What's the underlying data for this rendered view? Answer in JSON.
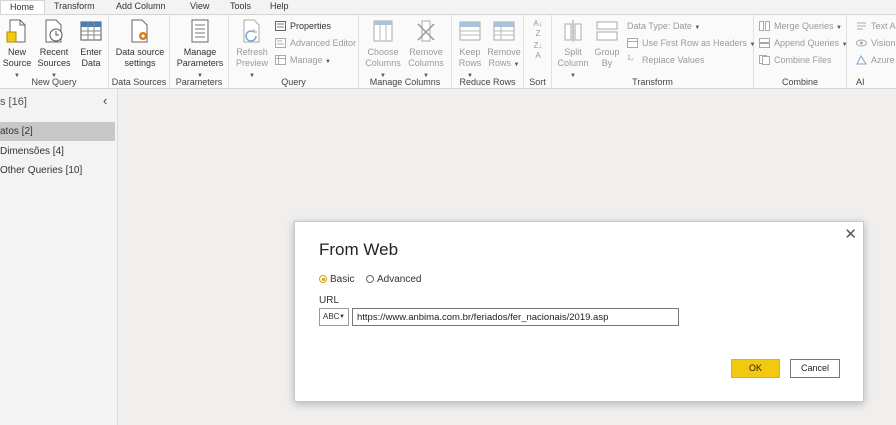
{
  "tabs": [
    "Home",
    "Transform",
    "Add Column",
    "View",
    "Tools",
    "Help"
  ],
  "ribbon": {
    "new_query": {
      "label": "New Query",
      "new_source": [
        "New",
        "Source"
      ],
      "recent_sources": [
        "Recent",
        "Sources"
      ],
      "enter_data": [
        "Enter",
        "Data"
      ]
    },
    "data_sources": {
      "label": "Data Sources",
      "settings": [
        "Data source",
        "settings"
      ]
    },
    "parameters": {
      "label": "Parameters",
      "manage": [
        "Manage",
        "Parameters"
      ]
    },
    "query": {
      "label": "Query",
      "refresh": [
        "Refresh",
        "Preview"
      ],
      "properties": "Properties",
      "advanced_editor": "Advanced Editor",
      "manage": "Manage"
    },
    "manage_columns": {
      "label": "Manage Columns",
      "choose": [
        "Choose",
        "Columns"
      ],
      "remove": [
        "Remove",
        "Columns"
      ]
    },
    "reduce_rows": {
      "label": "Reduce Rows",
      "keep": [
        "Keep",
        "Rows"
      ],
      "remove": [
        "Remove",
        "Rows"
      ]
    },
    "sort": {
      "label": "Sort"
    },
    "transform": {
      "label": "Transform",
      "split": [
        "Split",
        "Column"
      ],
      "group": [
        "Group",
        "By"
      ],
      "data_type": "Data Type: Date",
      "first_row": "Use First Row as Headers",
      "replace": "Replace Values"
    },
    "combine": {
      "label": "Combine",
      "merge": "Merge Queries",
      "append": "Append Queries",
      "files": "Combine Files"
    },
    "ai": {
      "label": "AI",
      "text": "Text An",
      "vision": "Vision",
      "azure": "Azure I"
    }
  },
  "queries_pane": {
    "title": "s [16]",
    "items": [
      "atos [2]",
      "Dimensões [4]",
      "Other Queries [10]"
    ]
  },
  "dialog": {
    "title": "From Web",
    "radio_basic": "Basic",
    "radio_advanced": "Advanced",
    "url_label": "URL",
    "type_value": "ABC",
    "url_value": "https://www.anbima.com.br/feriados/fer_nacionais/2019.asp",
    "ok": "OK",
    "cancel": "Cancel"
  },
  "colors": {
    "accent_yellow": "#f2c811",
    "ribbon_bg": "#fafafa",
    "pane_bg": "#f3f3f3",
    "selected_row": "#c8c8c8"
  }
}
